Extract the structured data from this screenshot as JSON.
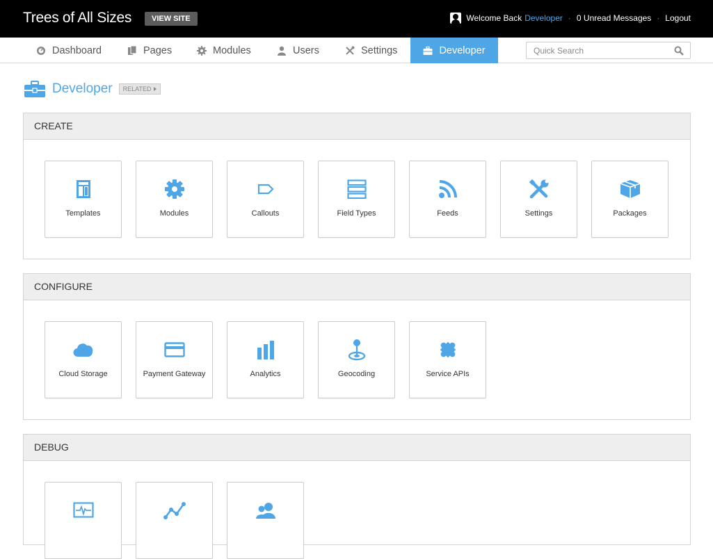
{
  "header": {
    "site_title": "Trees of All Sizes",
    "view_site_label": "VIEW SITE",
    "welcome_text": "Welcome Back",
    "user_name": "Developer",
    "messages_label": "0 Unread Messages",
    "logout_label": "Logout"
  },
  "nav": {
    "items": [
      {
        "label": "Dashboard",
        "icon": "dashboard-icon"
      },
      {
        "label": "Pages",
        "icon": "pages-icon"
      },
      {
        "label": "Modules",
        "icon": "gear-icon"
      },
      {
        "label": "Users",
        "icon": "user-icon"
      },
      {
        "label": "Settings",
        "icon": "tools-icon"
      },
      {
        "label": "Developer",
        "icon": "briefcase-icon",
        "active": true
      }
    ],
    "search_placeholder": "Quick Search"
  },
  "page": {
    "title": "Developer",
    "related_label": "RELATED"
  },
  "sections": [
    {
      "title": "CREATE",
      "tiles": [
        {
          "label": "Templates",
          "icon": "template-icon"
        },
        {
          "label": "Modules",
          "icon": "gear-icon"
        },
        {
          "label": "Callouts",
          "icon": "callout-icon"
        },
        {
          "label": "Field Types",
          "icon": "field-types-icon"
        },
        {
          "label": "Feeds",
          "icon": "rss-icon"
        },
        {
          "label": "Settings",
          "icon": "tools-icon"
        },
        {
          "label": "Packages",
          "icon": "package-icon"
        }
      ]
    },
    {
      "title": "CONFIGURE",
      "tiles": [
        {
          "label": "Cloud Storage",
          "icon": "cloud-icon"
        },
        {
          "label": "Payment Gateway",
          "icon": "credit-card-icon"
        },
        {
          "label": "Analytics",
          "icon": "bar-chart-icon"
        },
        {
          "label": "Geocoding",
          "icon": "map-pin-icon"
        },
        {
          "label": "Service APIs",
          "icon": "puzzle-icon"
        }
      ]
    },
    {
      "title": "DEBUG",
      "tiles": [
        {
          "label": "",
          "icon": "monitor-pulse-icon"
        },
        {
          "label": "",
          "icon": "line-graph-icon"
        },
        {
          "label": "",
          "icon": "users-icon"
        }
      ]
    }
  ],
  "colors": {
    "accent": "#4fa6e6",
    "topbar": "#000000",
    "section_header": "#eeeeee"
  }
}
